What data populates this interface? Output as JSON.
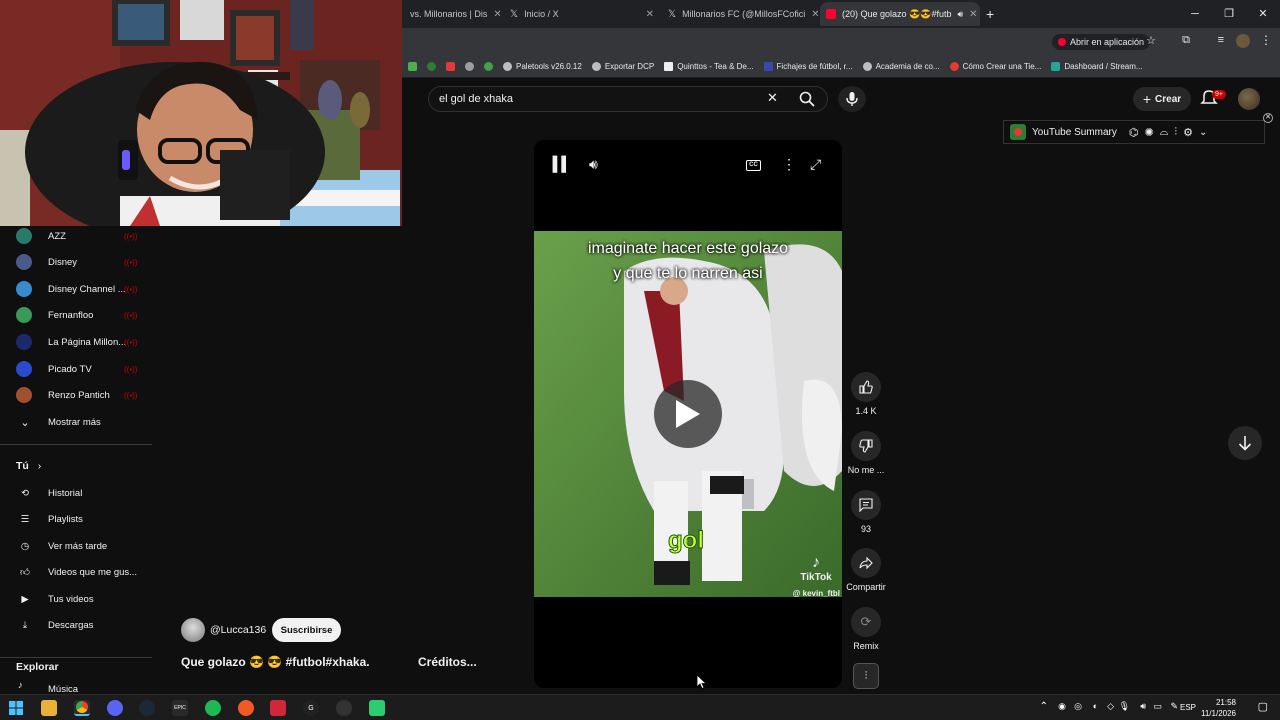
{
  "browser": {
    "tabs": [
      {
        "label": "vs. Millonarios | Dis",
        "active": false
      },
      {
        "label": "Inicio / X",
        "active": false
      },
      {
        "label": "Millonarios FC (@MillosFCofici",
        "active": false
      },
      {
        "label": "(20) Que golazo 😎😎#futb",
        "active": true
      }
    ],
    "new_tab": "+",
    "open_in_app": "Abrir en aplicación",
    "bookmarks": [
      "Paletools v26.0.12",
      "Exportar DCP",
      "Quinttos - Tea & De...",
      "Fichajes de fútbol, r...",
      "Academia de co...",
      "Cómo Crear una Tie...",
      "Dashboard / Stream..."
    ]
  },
  "youtube": {
    "search_query": "el gol de xhaka",
    "create_label": "Crear",
    "notifications_badge": "9+",
    "summary_label": "YouTube Summary",
    "sidebar": {
      "channels": [
        {
          "label": "AZZ",
          "color": "#2a7a6a"
        },
        {
          "label": "Disney",
          "color": "#4a5a8a"
        },
        {
          "label": "Disney Channel ...",
          "color": "#3a8ad0"
        },
        {
          "label": "Fernanfloo",
          "color": "#3a9a5a"
        },
        {
          "label": "La Página Millon...",
          "color": "#1a2a6a"
        },
        {
          "label": "Picado TV",
          "color": "#2a4ad0"
        },
        {
          "label": "Renzo Pantich",
          "color": "#a05030"
        }
      ],
      "show_more": "Mostrar más",
      "you_header": "Tú",
      "you_items": [
        "Historial",
        "Playlists",
        "Ver más tarde",
        "Videos que me gus...",
        "Tus videos",
        "Descargas"
      ],
      "explore_header": "Explorar",
      "explore_items": [
        "Música"
      ]
    },
    "video": {
      "caption_line1": "imaginate hacer este golazo",
      "caption_line2": "y que te lo narren asi",
      "overlay_word": "gol",
      "tiktok_label": "TikTok",
      "tiktok_user": "@ kevin_ftbl",
      "title": "Que golazo 😎 😎 #futbol#xhaka.",
      "credits": "Créditos...",
      "channel": "@Lucca136",
      "subscribe": "Suscribirse"
    },
    "actions": {
      "likes": "1.4 K",
      "dislike": "No me ...",
      "comments": "93",
      "share": "Compartir",
      "remix": "Remix"
    }
  },
  "taskbar": {
    "language": "ESP",
    "time": "21:58",
    "date": "11/1/2026"
  }
}
